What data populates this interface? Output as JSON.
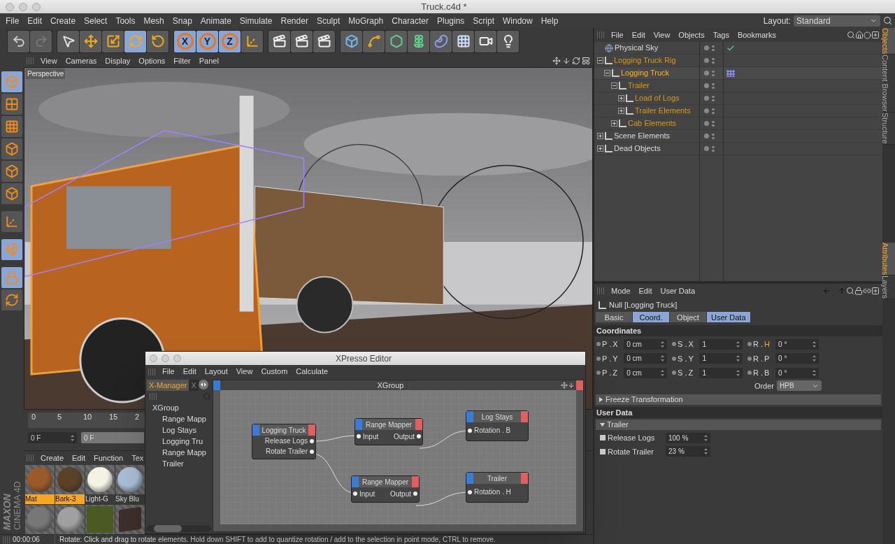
{
  "window": {
    "title": "Truck.c4d *"
  },
  "menu": [
    "File",
    "Edit",
    "Create",
    "Select",
    "Tools",
    "Mesh",
    "Snap",
    "Animate",
    "Simulate",
    "Render",
    "Sculpt",
    "MoGraph",
    "Character",
    "Plugins",
    "Script",
    "Window",
    "Help"
  ],
  "layout": {
    "label": "Layout:",
    "value": "Standard"
  },
  "toolbar": [
    {
      "selected": false
    },
    {
      "selected": false
    },
    {
      "selected": false
    },
    {
      "selected": false
    },
    {
      "selected": false
    },
    {
      "selected": true
    },
    {
      "selected": false
    },
    {
      "label": "X",
      "selected": true
    },
    {
      "label": "Y",
      "selected": true
    },
    {
      "label": "Z",
      "selected": true
    },
    {
      "selected": false
    },
    {
      "selected": false
    },
    {
      "selected": false
    },
    {
      "selected": false
    },
    {
      "selected": false
    },
    {
      "selected": false
    },
    {
      "selected": false
    },
    {
      "selected": false
    },
    {
      "selected": false
    },
    {
      "selected": false
    },
    {
      "selected": false
    },
    {
      "selected": false
    }
  ],
  "tool_strip": [
    {
      "selected": true
    },
    {
      "selected": false
    },
    {
      "selected": false
    },
    {
      "selected": false
    },
    {
      "selected": false
    },
    {
      "selected": false
    },
    {
      "selected": false
    },
    {
      "selected": true
    },
    {
      "selected": true
    },
    {
      "selected": false
    }
  ],
  "viewport": {
    "menu": [
      "View",
      "Cameras",
      "Display",
      "Options",
      "Filter",
      "Panel"
    ],
    "camera": "Perspective"
  },
  "timeline": {
    "ticks": [
      "0",
      "5",
      "10",
      "15",
      "2"
    ],
    "current_frame": "0 F",
    "start_frame": "0 F"
  },
  "materials": {
    "menu": [
      "Create",
      "Edit",
      "Function",
      "Tex"
    ],
    "items": [
      {
        "name": "Mat",
        "selected": true,
        "kind": "sphere",
        "color": "#9a5a2a"
      },
      {
        "name": "Bark-3",
        "selected": true,
        "kind": "sphere",
        "color": "#5a4128"
      },
      {
        "name": "Light-G",
        "selected": false,
        "kind": "sphere",
        "color": "#f4f2e4"
      },
      {
        "name": "Sky Blu",
        "selected": false,
        "kind": "sphere",
        "color": "#a9bdd6"
      },
      {
        "kind": "sphere",
        "color": "#777777"
      },
      {
        "kind": "sphere",
        "color": "#a0a0a0"
      },
      {
        "kind": "flat",
        "color": "#4a5a22"
      },
      {
        "kind": "cube",
        "color": "#3d302c"
      }
    ]
  },
  "brand": {
    "line1": "MAXON",
    "line2": "CINEMA 4D"
  },
  "status_bar": {
    "time": "00:00:06",
    "message": "Rotate: Click and drag to rotate elements. Hold down SHIFT to add to quantize rotation / add to the selection in point mode, CTRL to remove."
  },
  "objects": {
    "menu": [
      "File",
      "Edit",
      "View",
      "Objects",
      "Tags",
      "Bookmarks"
    ],
    "tree": [
      {
        "name": "Physical Sky",
        "kind": "sky",
        "selected": false,
        "tag": {
          "kind": "check"
        }
      },
      {
        "name": "Logging Truck Rig",
        "kind": "null",
        "selected": true,
        "expanded": true,
        "children": [
          {
            "name": "Logging Truck",
            "kind": "null",
            "selected": true,
            "active": true,
            "expanded": true,
            "tag": {
              "kind": "xpresso"
            },
            "children": [
              {
                "name": "Trailer",
                "kind": "null",
                "selected": true,
                "expanded": true,
                "children": [
                  {
                    "name": "Load of Logs",
                    "kind": "null",
                    "selected": true,
                    "expanded": false
                  },
                  {
                    "name": "Trailer Elements",
                    "kind": "null",
                    "selected": true,
                    "expanded": false
                  }
                ]
              },
              {
                "name": "Cab Elements",
                "kind": "null",
                "selected": true,
                "expanded": false
              }
            ]
          }
        ]
      },
      {
        "name": "Scene Elements",
        "kind": "null",
        "selected": false,
        "expanded": false
      },
      {
        "name": "Dead Objects",
        "kind": "null",
        "selected": false,
        "expanded": false
      }
    ]
  },
  "side_tabs_top": [
    {
      "label": "Objects",
      "selected": true
    },
    {
      "label": "Content Browser",
      "selected": false
    },
    {
      "label": "Structure",
      "selected": false
    }
  ],
  "attributes": {
    "menu": [
      "Mode",
      "Edit",
      "User Data"
    ],
    "object": "Null [Logging Truck]",
    "tabs": [
      {
        "label": "Basic",
        "selected": false
      },
      {
        "label": "Coord.",
        "selected": true
      },
      {
        "label": "Object",
        "selected": false
      },
      {
        "label": "User Data",
        "selected": true
      }
    ],
    "section": "Coordinates",
    "fields": [
      {
        "prefix": "P .",
        "axis": "X",
        "value": "0 cm",
        "highlighted": false
      },
      {
        "prefix": "S .",
        "axis": "X",
        "value": "1",
        "highlighted": false
      },
      {
        "prefix": "R .",
        "axis": "H",
        "value": "0 °",
        "highlighted": true
      },
      {
        "prefix": "P .",
        "axis": "Y",
        "value": "0 cm",
        "highlighted": false
      },
      {
        "prefix": "S .",
        "axis": "Y",
        "value": "1",
        "highlighted": false
      },
      {
        "prefix": "R .",
        "axis": "P",
        "value": "0 °",
        "highlighted": false
      },
      {
        "prefix": "P .",
        "axis": "Z",
        "value": "0 cm",
        "highlighted": false
      },
      {
        "prefix": "S .",
        "axis": "Z",
        "value": "1",
        "highlighted": false
      },
      {
        "prefix": "R .",
        "axis": "B",
        "value": "0 °",
        "highlighted": false
      }
    ],
    "order": {
      "label": "Order",
      "value": "HPB"
    },
    "freeze": {
      "title": "Freeze Transformation",
      "expanded": false
    },
    "user_data": {
      "title": "User Data",
      "group": {
        "title": "Trailer",
        "expanded": true
      },
      "params": [
        {
          "label": "Release Logs",
          "value": "100 %"
        },
        {
          "label": "Rotate Trailer",
          "value": "23 %"
        }
      ]
    }
  },
  "side_tabs_bottom": [
    {
      "label": "Attributes",
      "selected": true
    },
    {
      "label": "Layers",
      "selected": false
    }
  ],
  "xpresso": {
    "title": "XPresso Editor",
    "menu": [
      "File",
      "Edit",
      "Layout",
      "View",
      "Custom",
      "Calculate"
    ],
    "tabs": [
      {
        "label": "X-Manager",
        "selected": true
      },
      {
        "label": "X",
        "selected": false
      }
    ],
    "tree": {
      "name": "XGroup",
      "children": [
        "Range Mapp",
        "Log Stays",
        "Logging Tru",
        "Range Mapp",
        "Trailer"
      ]
    },
    "graph": {
      "title": "XGroup",
      "nodes": [
        {
          "title": "Logging Truck",
          "ports": [
            {
              "name": "Release Logs",
              "kind": "output"
            },
            {
              "name": "Rotate Trailer",
              "kind": "output"
            }
          ]
        },
        {
          "title": "Range Mapper",
          "ports": [
            {
              "name": "Input",
              "kind": "input"
            },
            {
              "name": "Output",
              "kind": "output"
            }
          ]
        },
        {
          "title": "Log Stays",
          "ports": [
            {
              "name": "Rotation . B",
              "kind": "input"
            }
          ]
        },
        {
          "title": "Range Mapper",
          "ports": [
            {
              "name": "Input",
              "kind": "input"
            },
            {
              "name": "Output",
              "kind": "output"
            }
          ]
        },
        {
          "title": "Trailer",
          "ports": [
            {
              "name": "Rotation . H",
              "kind": "input"
            }
          ]
        }
      ]
    }
  }
}
